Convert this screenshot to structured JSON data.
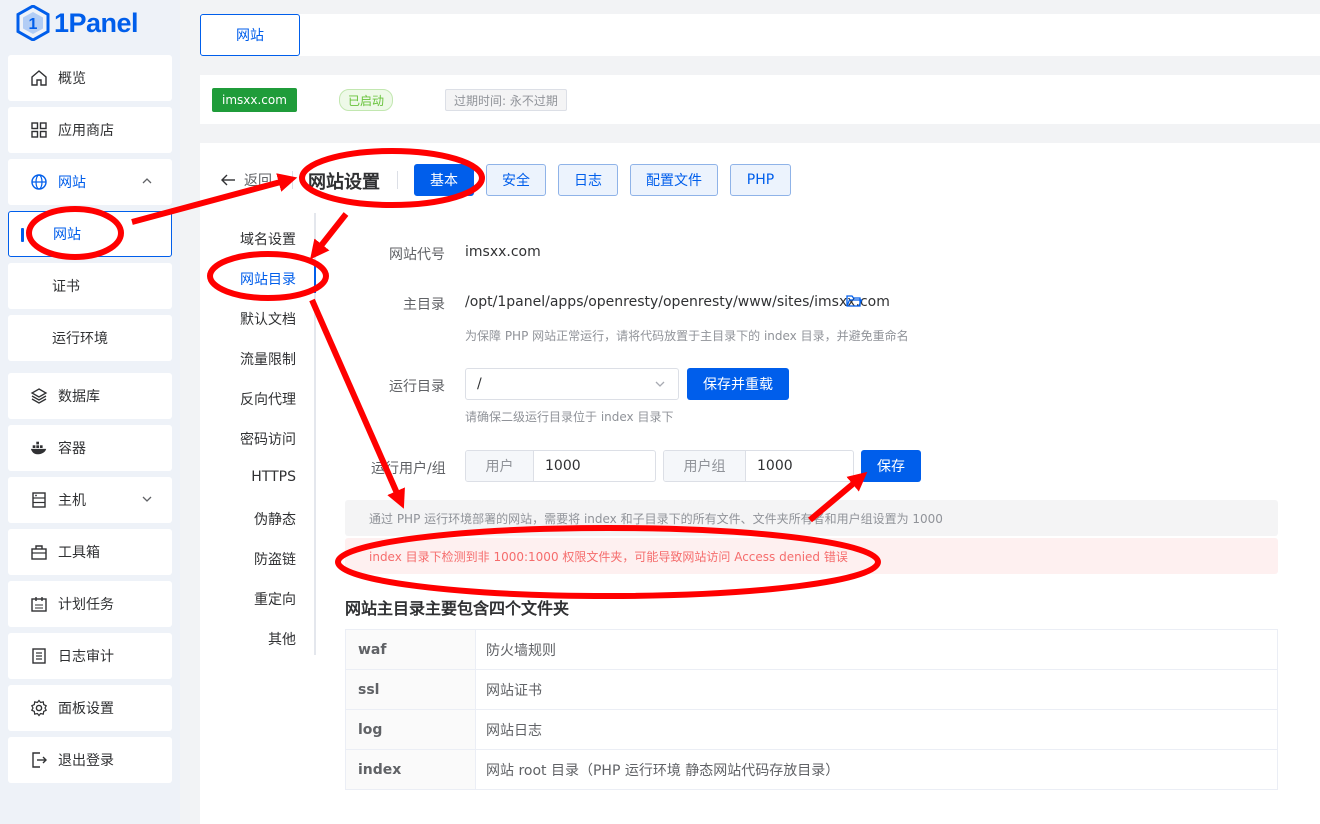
{
  "app": {
    "logo_text": "1Panel"
  },
  "sidebar": {
    "items": [
      {
        "label": "概览"
      },
      {
        "label": "应用商店"
      },
      {
        "label": "网站"
      },
      {
        "label": "网站"
      },
      {
        "label": "证书"
      },
      {
        "label": "运行环境"
      },
      {
        "label": "数据库"
      },
      {
        "label": "容器"
      },
      {
        "label": "主机"
      },
      {
        "label": "工具箱"
      },
      {
        "label": "计划任务"
      },
      {
        "label": "日志审计"
      },
      {
        "label": "面板设置"
      },
      {
        "label": "退出登录"
      }
    ]
  },
  "top_tab": {
    "label": "网站"
  },
  "site_info": {
    "domain_tag": "imsxx.com",
    "status": "已启动",
    "expire": "过期时间: 永不过期"
  },
  "header": {
    "back_label": "返回",
    "title": "网站设置",
    "tabs": [
      "基本",
      "安全",
      "日志",
      "配置文件",
      "PHP"
    ]
  },
  "subnav": {
    "items": [
      "域名设置",
      "网站目录",
      "默认文档",
      "流量限制",
      "反向代理",
      "密码访问",
      "HTTPS",
      "伪静态",
      "防盗链",
      "重定向",
      "其他"
    ]
  },
  "form": {
    "alias_label": "网站代号",
    "alias_value": "imsxx.com",
    "root_label": "主目录",
    "root_value": "/opt/1panel/apps/openresty/openresty/www/sites/imsxx.com",
    "root_hint": "为保障 PHP 网站正常运行，请将代码放置于主目录下的 index 目录，并避免重命名",
    "run_dir_label": "运行目录",
    "run_dir_value": "/",
    "save_reload_label": "保存并重载",
    "run_dir_hint": "请确保二级运行目录位于 index 目录下",
    "user_group_label": "运行用户/组",
    "user_prefix": "用户",
    "user_value": "1000",
    "group_prefix": "用户组",
    "group_value": "1000",
    "save_label": "保存"
  },
  "alerts": {
    "info": "通过 PHP 运行环境部署的网站，需要将 index 和子目录下的所有文件、文件夹所有者和用户组设置为 1000",
    "error": "index 目录下检测到非 1000:1000 权限文件夹，可能导致网站访问 Access denied 错误"
  },
  "dir_section": {
    "title": "网站主目录主要包含四个文件夹",
    "rows": [
      {
        "name": "waf",
        "desc": "防火墙规则"
      },
      {
        "name": "ssl",
        "desc": "网站证书"
      },
      {
        "name": "log",
        "desc": "网站日志"
      },
      {
        "name": "index",
        "desc": "网站 root 目录（PHP 运行环境 静态网站代码存放目录）"
      }
    ]
  },
  "colors": {
    "primary": "#005eeb",
    "success": "#1f9c3a",
    "danger": "#f56c6c",
    "annotation": "#ff0000"
  }
}
